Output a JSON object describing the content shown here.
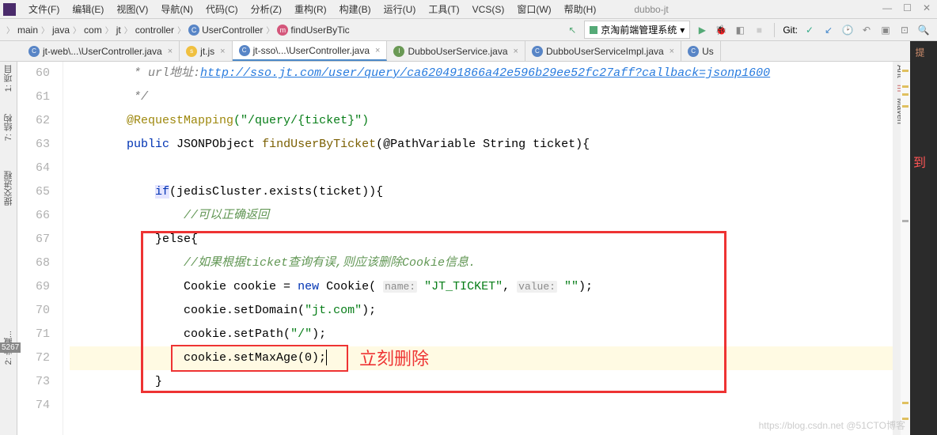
{
  "window": {
    "project": "dubbo-jt",
    "menus": [
      "文件(F)",
      "编辑(E)",
      "视图(V)",
      "导航(N)",
      "代码(C)",
      "分析(Z)",
      "重构(R)",
      "构建(B)",
      "运行(U)",
      "工具(T)",
      "VCS(S)",
      "窗口(W)",
      "帮助(H)"
    ]
  },
  "breadcrumb": {
    "items": [
      "main",
      "java",
      "com",
      "jt",
      "controller"
    ],
    "class": "UserController",
    "method": "findUserByTic"
  },
  "run_config": "京淘前端管理系统",
  "git_label": "Git:",
  "tabs": [
    {
      "icon": "java",
      "label": "jt-web\\...\\UserController.java",
      "active": false
    },
    {
      "icon": "js",
      "label": "jt.js",
      "active": false
    },
    {
      "icon": "java",
      "label": "jt-sso\\...\\UserController.java",
      "active": true
    },
    {
      "icon": "iface",
      "label": "DubboUserService.java",
      "active": false
    },
    {
      "icon": "java",
      "label": "DubboUserServiceImpl.java",
      "active": false
    },
    {
      "icon": "java",
      "label": "Us",
      "active": false
    }
  ],
  "sidebars": {
    "left_top": "1: 项目",
    "left_mid": "7: 结构",
    "left_mid2": "提交进程",
    "left_bottom": "2: 收藏...",
    "right_top": "Ant",
    "right_2": "m",
    "right_3": "Maven"
  },
  "gutter": [
    "60",
    "61",
    "62",
    "63",
    "64",
    "65",
    "66",
    "67",
    "68",
    "69",
    "70",
    "71",
    "72",
    "73",
    "74",
    "5267"
  ],
  "code": {
    "l60_pre": "         * url地址:",
    "l60_url": "http://sso.jt.com/user/query/ca620491866a42e596b29ee52fc27aff?callback=jsonp1600",
    "l61": "         */",
    "l62_anno": "@RequestMapping",
    "l62_str": "(\"/query/{ticket}\")",
    "l63_kw": "public",
    "l63_type": " JSONPObject ",
    "l63_method": "findUserByTicket",
    "l63_rest": "(@PathVariable String ticket){",
    "l65_kw": "if",
    "l65_rest": "(jedisCluster.exists(ticket)){",
    "l66_comment": "//可以正确返回",
    "l67": "}else{",
    "l68_comment": "//如果根据ticket查询有误,则应该删除Cookie信息.",
    "l69_a": "Cookie cookie = ",
    "l69_kw": "new",
    "l69_b": " Cookie( ",
    "l69_hint1": "name:",
    "l69_str1": " \"JT_TICKET\"",
    "l69_c": ", ",
    "l69_hint2": "value:",
    "l69_str2": " \"\"",
    "l69_d": ");",
    "l70_a": "cookie.setDomain(",
    "l70_str": "\"jt.com\"",
    "l70_b": ");",
    "l71_a": "cookie.setPath(",
    "l71_str": "\"/\"",
    "l71_b": ");",
    "l72": "cookie.setMaxAge(0);",
    "l73": "}"
  },
  "annotation": "立刻删除",
  "watermark": "https://blog.csdn.net @51CTO博客"
}
